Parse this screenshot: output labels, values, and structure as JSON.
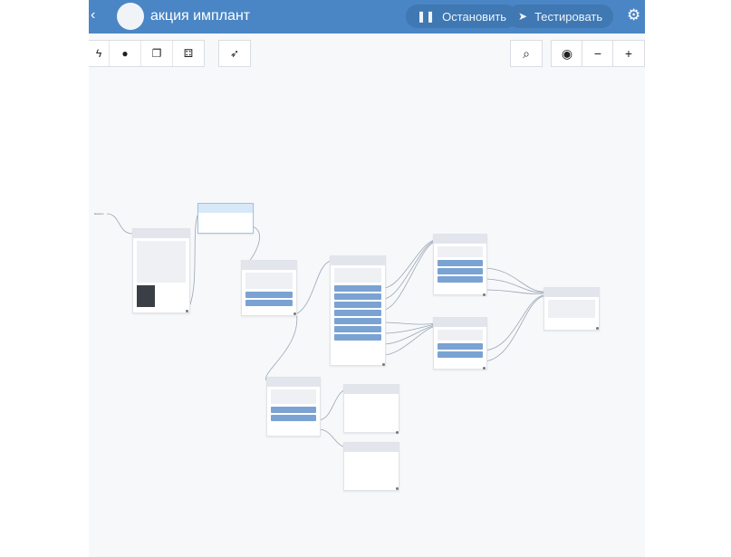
{
  "header": {
    "title": "акция имплант",
    "logo_text": "",
    "stop_label": "Остановить",
    "test_label": "Тестировать",
    "accent": "#4a86c5"
  },
  "toolbar": {
    "left_icons": [
      "lightning-icon",
      "user-icon",
      "copy-icon",
      "blocks-icon",
      "rocket-icon"
    ],
    "right_icons": [
      "search-icon",
      "target-icon",
      "zoom-out-icon",
      "zoom-in-icon"
    ]
  },
  "canvas": {
    "start_label": "Начало"
  }
}
